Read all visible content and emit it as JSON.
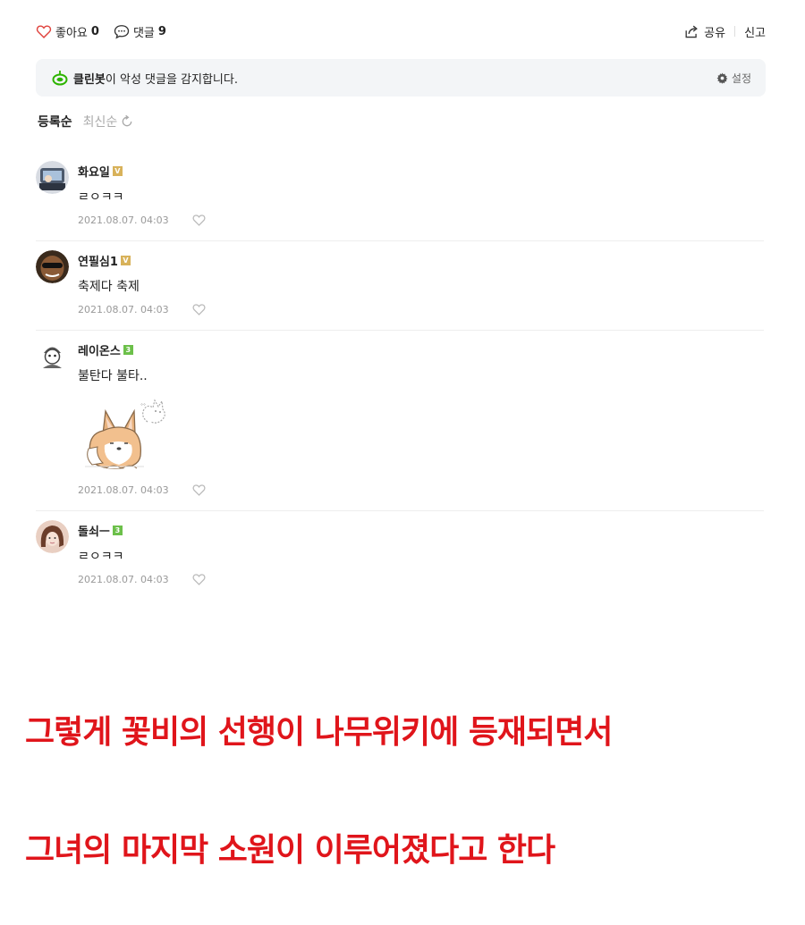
{
  "stats": {
    "like_label": "좋아요",
    "like_count": "0",
    "comment_label": "댓글",
    "comment_count": "9"
  },
  "actions": {
    "share": "공유",
    "report": "신고"
  },
  "cleanbot": {
    "brand": "클린봇",
    "message": "이 악성 댓글을 감지합니다.",
    "settings": "설정"
  },
  "sort": {
    "active": "등록순",
    "inactive": "최신순"
  },
  "comments": [
    {
      "name": "화요일",
      "badge": "V",
      "text": "ㄹㅇㅋㅋ",
      "date": "2021.08.07. 04:03"
    },
    {
      "name": "연필심1",
      "badge": "V",
      "text": "축제다 축제",
      "date": "2021.08.07. 04:03"
    },
    {
      "name": "레이온스",
      "badge": "3",
      "text": "불탄다 불타..",
      "date": "2021.08.07. 04:03"
    },
    {
      "name": "돌쇠ㅡ",
      "badge": "3",
      "text": "ㄹㅇㅋㅋ",
      "date": "2021.08.07. 04:03"
    }
  ],
  "captions": [
    "그렇게 꽃비의 선행이 나무위키에 등재되면서",
    "그녀의 마지막 소원이 이루어졌다고 한다"
  ],
  "colors": {
    "caption": "#e0151b",
    "badge_gold": "#d8b25a",
    "badge_green": "#6cc04a",
    "cleanbot_bg": "#f3f5f7",
    "like_red": "#e0443e"
  }
}
